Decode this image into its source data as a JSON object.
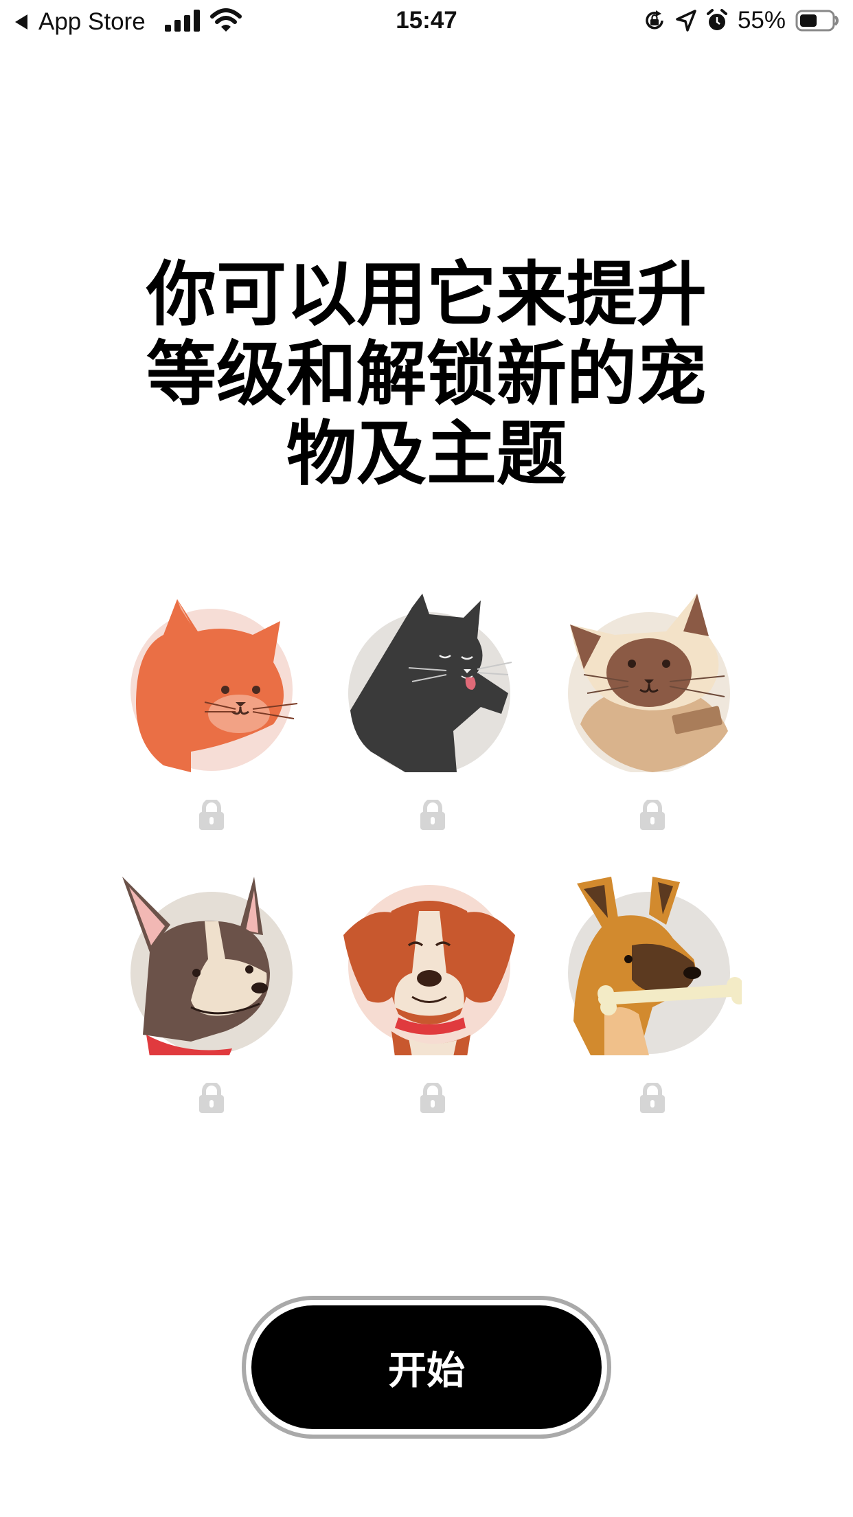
{
  "status_bar": {
    "back_app": "App Store",
    "time": "15:47",
    "battery_percent": "55%",
    "battery_level": 0.55
  },
  "headline": "你可以用它来提升等级和解锁新的宠物及主题",
  "pets": [
    {
      "name": "orange-cat",
      "locked": true,
      "colors": {
        "bg": "#f6ddd6",
        "fur": "#ea6f45"
      }
    },
    {
      "name": "black-cat",
      "locked": true,
      "colors": {
        "bg": "#e4e1dd",
        "fur": "#3a3a3a"
      }
    },
    {
      "name": "siamese-cat",
      "locked": true,
      "colors": {
        "bg": "#efe7dc",
        "fur": "#d9b38c"
      }
    },
    {
      "name": "boston-terrier",
      "locked": true,
      "colors": {
        "bg": "#e4ded6",
        "fur": "#6b5249"
      }
    },
    {
      "name": "beagle",
      "locked": true,
      "colors": {
        "bg": "#f6dcd2",
        "fur": "#c8582e"
      }
    },
    {
      "name": "shepherd-dog",
      "locked": true,
      "colors": {
        "bg": "#e4e1dd",
        "fur": "#d28a2e"
      }
    }
  ],
  "start_button": {
    "label": "开始"
  },
  "colors": {
    "lock": "#d5d5d5",
    "button_bg": "#000000",
    "button_border": "#a9a9a9"
  }
}
